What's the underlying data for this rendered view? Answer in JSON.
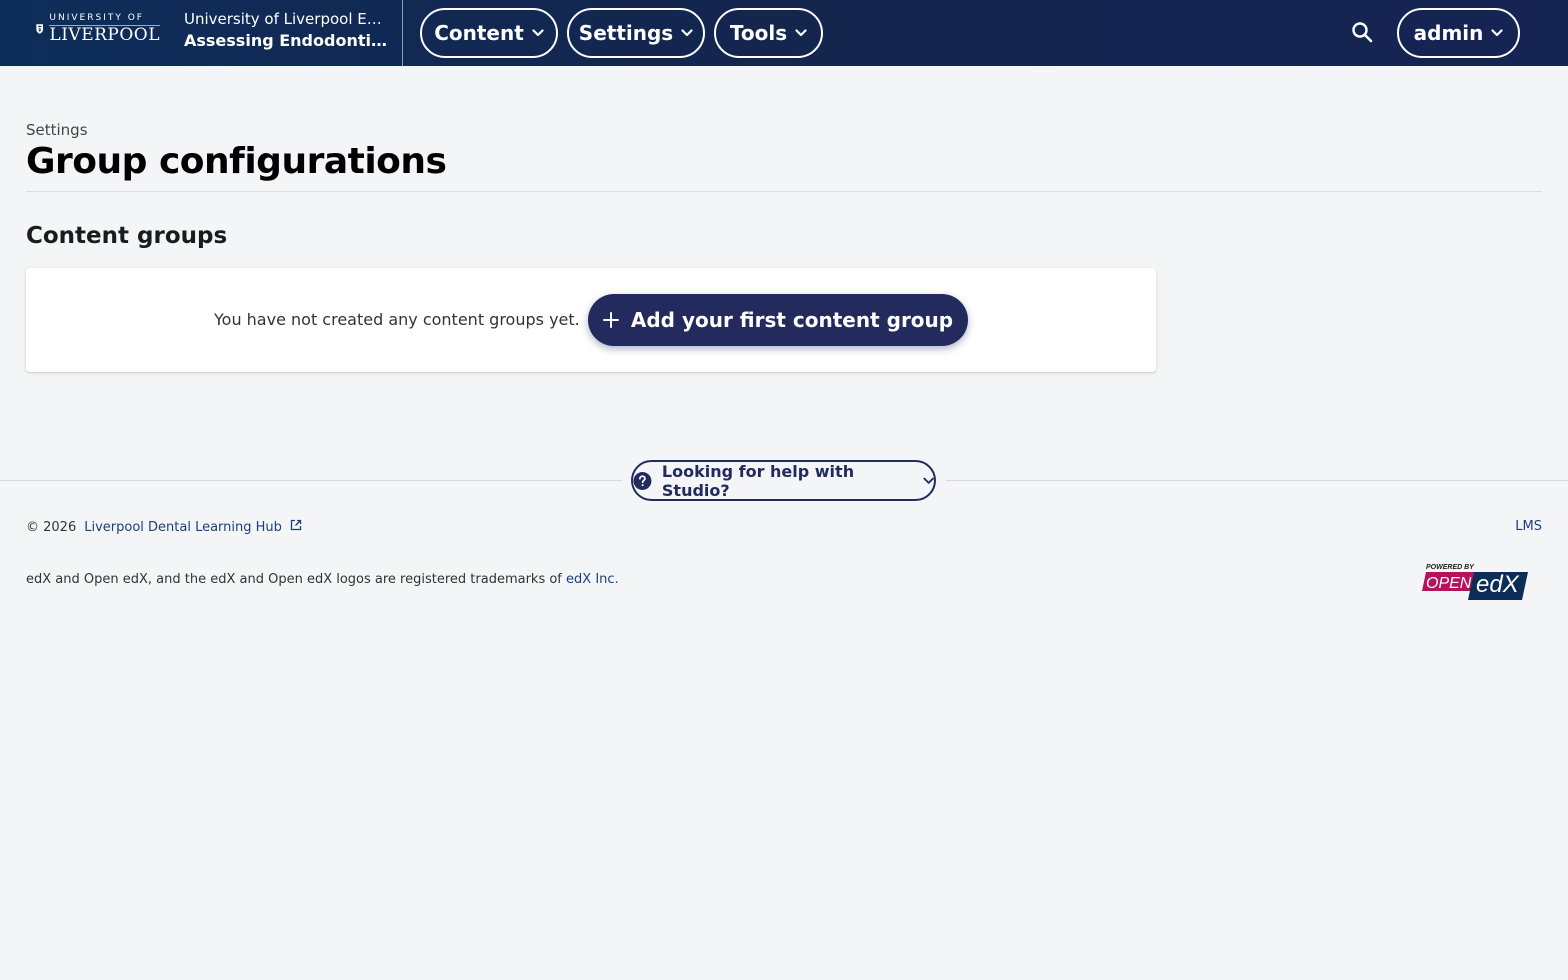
{
  "header": {
    "logo_top": "UNIVERSITY OF",
    "logo_bottom": "LIVERPOOL",
    "course_org": "University of Liverpool EN...",
    "course_name": "Assessing Endodonti...",
    "nav": [
      {
        "label": "Content",
        "icon": "chevron-down-icon"
      },
      {
        "label": "Settings",
        "icon": "chevron-down-icon"
      },
      {
        "label": "Tools",
        "icon": "chevron-down-icon"
      }
    ],
    "search_icon": "search-icon",
    "user_label": "admin"
  },
  "main": {
    "breadcrumb": "Settings",
    "title": "Group configurations",
    "section_title": "Content groups",
    "empty_text": "You have not created any content groups yet.",
    "add_button_label": "Add your first content group"
  },
  "help": {
    "label": "Looking for help with Studio?"
  },
  "footer": {
    "copyright": "© 2026",
    "site_link": "Liverpool Dental Learning Hub",
    "lms_link": "LMS",
    "trademark_text": "edX and Open edX, and the edX and Open edX logos are registered trademarks of",
    "trademark_link": "edX Inc.",
    "powered_by": "POWERED BY",
    "powered_open": "OPEN",
    "powered_edx": "edX"
  },
  "colors": {
    "header_bg": "#14254e",
    "primary": "#232b5e",
    "page_bg": "#f3f5f7",
    "link": "#1e3f7a",
    "openedx_magenta": "#b5135c"
  }
}
